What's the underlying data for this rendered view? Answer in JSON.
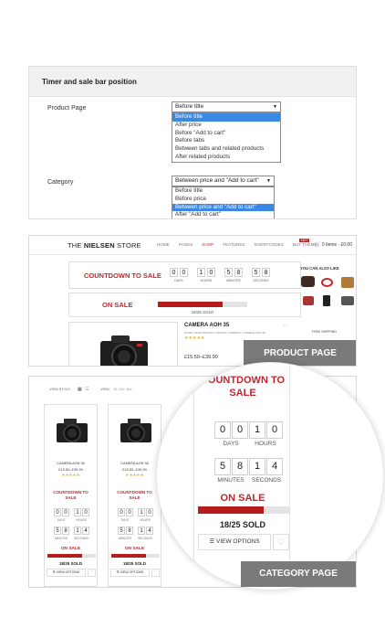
{
  "settings_panel": {
    "title": "Timer and sale bar position",
    "product_page": {
      "label": "Product Page",
      "selected": "Before title",
      "options": [
        "Before title",
        "After price",
        "Before \"Add to cart\"",
        "Before tabs",
        "Between tabs and related products",
        "After related products"
      ],
      "highlighted_index": 0
    },
    "category": {
      "label": "Category",
      "selected": "Between price and \"Add to cart\"",
      "options": [
        "Before title",
        "Before price",
        "Between price and \"Add to cart\"",
        "After \"Add to cart\""
      ],
      "highlighted_index": 2
    }
  },
  "product_preview": {
    "logo_prefix": "THE",
    "logo_bold": "NIELSEN",
    "logo_suffix": "STORE",
    "nav": [
      "HOME",
      "PAGES",
      "SHOP",
      "FEATURES",
      "SHORTCODES",
      "BUY THEME"
    ],
    "active_nav": "SHOP",
    "hot_badge": "HOT",
    "cart": "0 items · £0.00",
    "countdown_title": "COUNTDOWN TO SALE",
    "timer": [
      {
        "digits": [
          "0",
          "0"
        ],
        "unit": "DAYS"
      },
      {
        "digits": [
          "1",
          "0"
        ],
        "unit": "HOURS"
      },
      {
        "digits": [
          "5",
          "8"
        ],
        "unit": "MINUTES"
      },
      {
        "digits": [
          "5",
          "8"
        ],
        "unit": "SECONDS"
      }
    ],
    "on_sale": "ON SALE",
    "sold_text": "18/25 SOLD",
    "sold_fraction": 0.72,
    "product_name": "CAMERA AOH 35",
    "product_meta": "HOME / ELECTRONICS / DIGITAL CAMERAS / CAMERA AOH 35",
    "price": "£15.50–£39.90",
    "sidebar_title": "YOU CAN ALSO LIKE",
    "free_shipping": "FREE SHIPPING",
    "badge": "PRODUCT PAGE"
  },
  "category_preview": {
    "view_style_label": "VIEW STYLE:",
    "view_label": "VIEW:",
    "view_options": "12 / 24 / ALL",
    "card_name": "CAMERA AOH 35",
    "card_price": "£15.50–£39.90",
    "card_stars": "★★★★★",
    "countdown_line1": "COUNTDOWN TO",
    "countdown_line2": "SALE",
    "timer_top": [
      {
        "digits": [
          "0",
          "0"
        ],
        "unit": "DAYS"
      },
      {
        "digits": [
          "1",
          "0"
        ],
        "unit": "HOURS"
      }
    ],
    "timer_bottom": [
      {
        "digits": [
          "5",
          "8"
        ],
        "unit": "MINUTES"
      },
      {
        "digits": [
          "1",
          "4"
        ],
        "unit": "SECONDS"
      }
    ],
    "on_sale": "ON SALE",
    "sold_text": "18/25 SOLD",
    "sold_fraction": 0.72,
    "view_options_button": "VIEW OPTIONS",
    "badge": "CATEGORY PAGE"
  },
  "colors": {
    "accent_red": "#c1272d",
    "highlight_blue": "#3b87e4",
    "badge_gray": "#7a7a7a"
  }
}
